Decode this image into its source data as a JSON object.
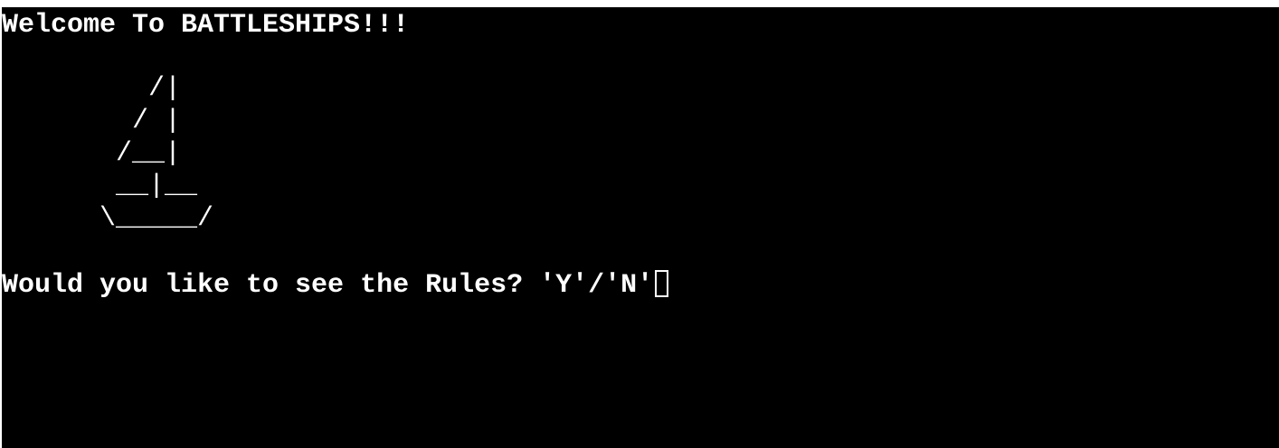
{
  "terminal": {
    "welcome": "Welcome To BATTLESHIPS!!!",
    "ship_art": "         /|\n        / |\n       /__|\n       __|__\n      \\_____/",
    "prompt": "Would you like to see the Rules? 'Y'/'N'",
    "background": "#000000",
    "foreground": "#ffffff"
  }
}
